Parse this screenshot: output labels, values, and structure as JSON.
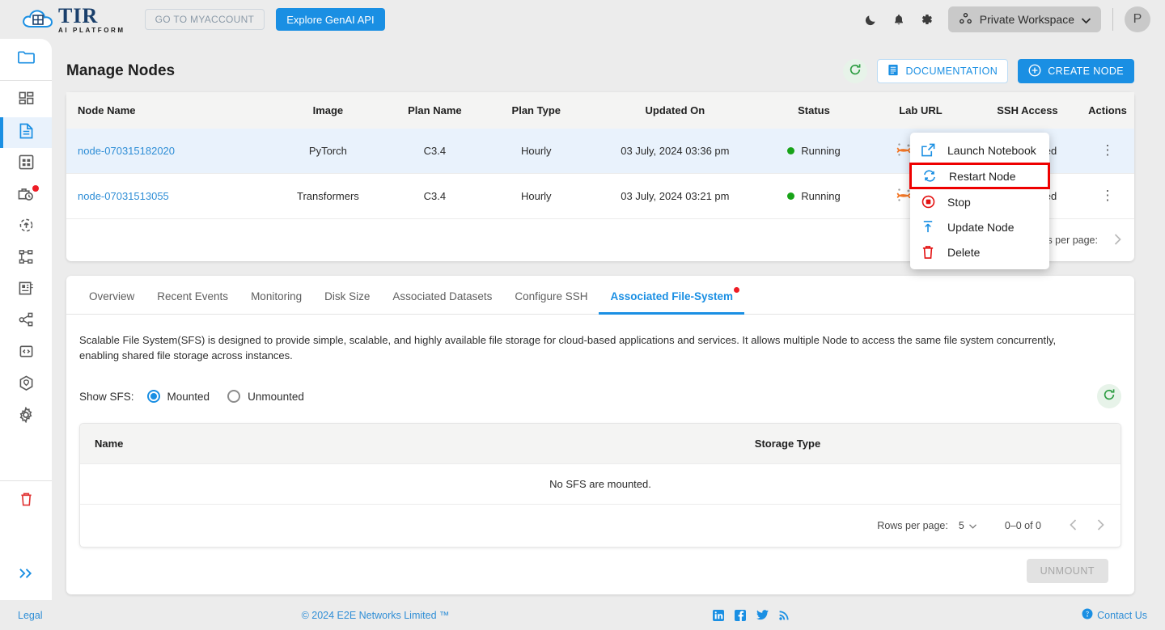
{
  "topbar": {
    "logo_title": "TIR",
    "logo_subtitle": "AI PLATFORM",
    "myaccount_label": "GO TO MYACCOUNT",
    "genai_label": "Explore GenAI API",
    "dark_mode_icon": "moon-icon",
    "notifications_icon": "bell-icon",
    "settings_icon": "gear-icon",
    "workspace_label": "Private Workspace",
    "workspace_icon": "workspace-nodes-icon",
    "chevron_icon": "chevron-down-icon",
    "avatar_initial": "P"
  },
  "sidebar": {
    "items": [
      {
        "name": "folder-icon",
        "active": false,
        "color": "blue",
        "badge": false
      },
      {
        "name": "dashboard-grid-icon",
        "active": false,
        "color": "grey",
        "badge": false
      },
      {
        "name": "document-icon",
        "active": true,
        "color": "blue",
        "badge": false
      },
      {
        "name": "table-icon",
        "active": false,
        "color": "grey",
        "badge": false
      },
      {
        "name": "briefcase-clock-icon",
        "active": false,
        "color": "grey",
        "badge": true
      },
      {
        "name": "rocket-launch-icon",
        "active": false,
        "color": "grey",
        "badge": false
      },
      {
        "name": "pipeline-icon",
        "active": false,
        "color": "grey",
        "badge": false
      },
      {
        "name": "server-icon",
        "active": false,
        "color": "grey",
        "badge": false
      },
      {
        "name": "share-nodes-icon",
        "active": false,
        "color": "grey",
        "badge": false
      },
      {
        "name": "code-terminal-icon",
        "active": false,
        "color": "grey",
        "badge": false
      },
      {
        "name": "cube-shield-icon",
        "active": false,
        "color": "grey",
        "badge": false
      },
      {
        "name": "settings-gear-icon",
        "active": false,
        "color": "grey",
        "badge": false
      }
    ],
    "trash_icon": "trash-icon",
    "expand_icon": "chevron-double-right-icon"
  },
  "page": {
    "title": "Manage Nodes",
    "refresh_icon": "refresh-icon",
    "documentation_label": "DOCUMENTATION",
    "documentation_icon": "document-list-icon",
    "create_node_label": "CREATE NODE",
    "create_node_icon": "plus-circle-icon"
  },
  "nodes_table": {
    "columns": [
      "Node Name",
      "Image",
      "Plan Name",
      "Plan Type",
      "Updated On",
      "Status",
      "Lab URL",
      "SSH Access",
      "Actions"
    ],
    "rows": [
      {
        "node_name": "node-070315182020",
        "image": "PyTorch",
        "plan_name": "C3.4",
        "plan_type": "Hourly",
        "updated_on": "03 July, 2024 03:36 pm",
        "status": "Running",
        "lab_url": "jupyter",
        "ssh_access": "Disabled",
        "selected": true
      },
      {
        "node_name": "node-07031513055",
        "image": "Transformers",
        "plan_name": "C3.4",
        "plan_type": "Hourly",
        "updated_on": "03 July, 2024 03:21 pm",
        "status": "Running",
        "lab_url": "jupyter",
        "ssh_access": "Disabled",
        "selected": false
      }
    ],
    "rows_per_page_label": "Rows per page:"
  },
  "actions_menu": {
    "items": [
      {
        "label": "Launch Notebook",
        "icon": "external-link-icon",
        "highlighted": false
      },
      {
        "label": "Restart Node",
        "icon": "restart-icon",
        "highlighted": true
      },
      {
        "label": "Stop",
        "icon": "stop-circle-icon",
        "highlighted": false
      },
      {
        "label": "Update Node",
        "icon": "upload-arrow-icon",
        "highlighted": false
      },
      {
        "label": "Delete",
        "icon": "trash-icon",
        "highlighted": false
      }
    ],
    "highlight_color": "#ee0000"
  },
  "tabs": [
    {
      "label": "Overview",
      "active": false,
      "badge": false
    },
    {
      "label": "Recent Events",
      "active": false,
      "badge": false
    },
    {
      "label": "Monitoring",
      "active": false,
      "badge": false
    },
    {
      "label": "Disk Size",
      "active": false,
      "badge": false
    },
    {
      "label": "Associated Datasets",
      "active": false,
      "badge": false
    },
    {
      "label": "Configure SSH",
      "active": false,
      "badge": false
    },
    {
      "label": "Associated File-System",
      "active": true,
      "badge": true
    }
  ],
  "sfs_panel": {
    "description": "Scalable File System(SFS) is designed to provide simple, scalable, and highly available file storage for cloud-based applications and services. It allows multiple Node to access the same file system concurrently, enabling shared file storage across instances.",
    "show_sfs_label": "Show SFS:",
    "option_mounted": "Mounted",
    "option_unmounted": "Unmounted",
    "selected_option": "Mounted",
    "refresh_icon": "refresh-icon",
    "columns": [
      "Name",
      "Storage Type"
    ],
    "empty_message": "No SFS are mounted.",
    "rows_per_page_label": "Rows per page:",
    "rows_per_page_value": "5",
    "range_label": "0–0 of 0",
    "prev_icon": "chevron-left-icon",
    "next_icon": "chevron-right-icon",
    "unmount_label": "UNMOUNT"
  },
  "footer": {
    "legal": "Legal",
    "copyright": "© 2024 E2E Networks Limited ™",
    "social": [
      "linkedin-icon",
      "facebook-icon",
      "twitter-icon",
      "rss-icon"
    ],
    "contact": "Contact Us",
    "contact_icon": "help-circle-icon"
  },
  "colors": {
    "accent": "#1a8fe3",
    "danger": "#ee0000",
    "success": "#18a318",
    "warning": "#f5b301",
    "selected_row": "#e9f2fc",
    "header_bg": "#f4f4f3"
  }
}
